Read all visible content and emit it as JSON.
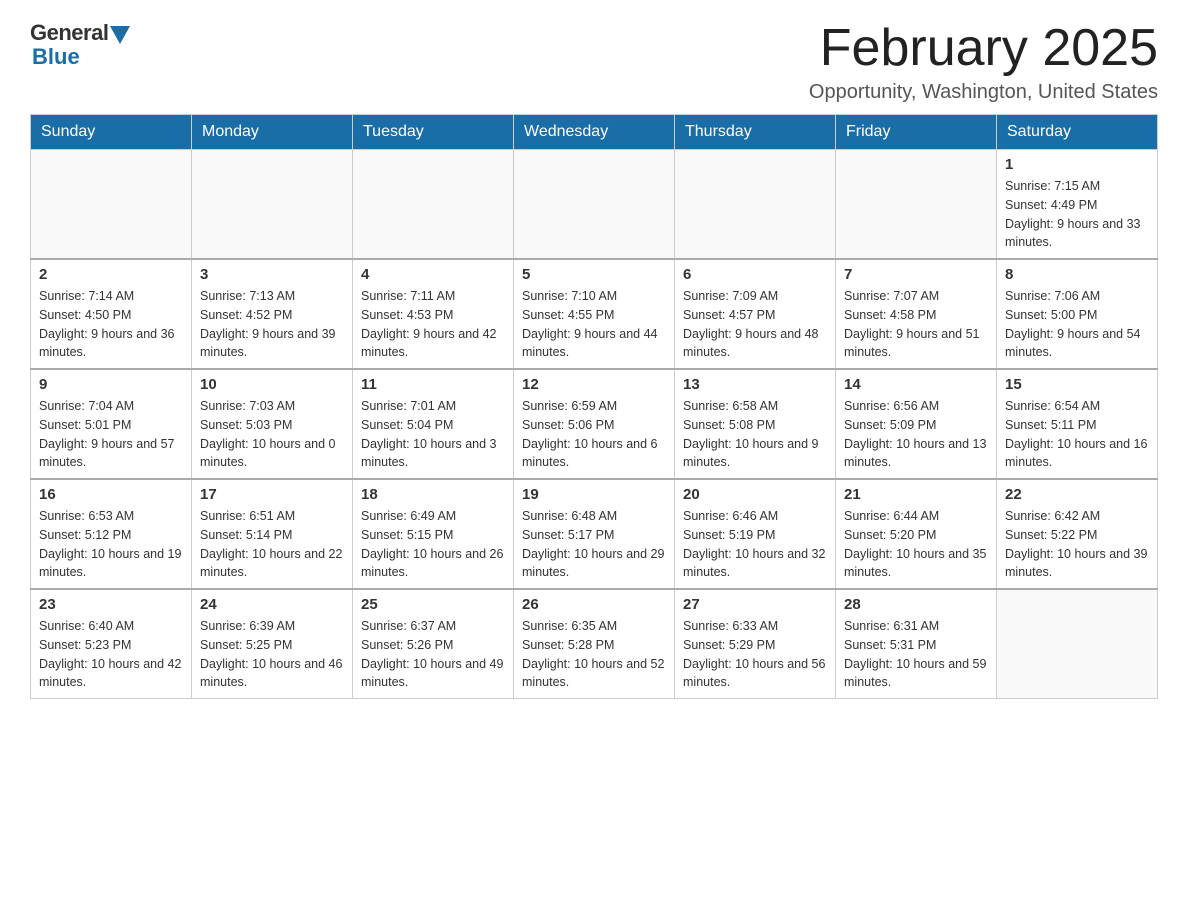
{
  "header": {
    "logo_general": "General",
    "logo_blue": "Blue",
    "month_title": "February 2025",
    "location": "Opportunity, Washington, United States"
  },
  "days_of_week": [
    "Sunday",
    "Monday",
    "Tuesday",
    "Wednesday",
    "Thursday",
    "Friday",
    "Saturday"
  ],
  "weeks": [
    [
      {
        "day": "",
        "info": ""
      },
      {
        "day": "",
        "info": ""
      },
      {
        "day": "",
        "info": ""
      },
      {
        "day": "",
        "info": ""
      },
      {
        "day": "",
        "info": ""
      },
      {
        "day": "",
        "info": ""
      },
      {
        "day": "1",
        "info": "Sunrise: 7:15 AM\nSunset: 4:49 PM\nDaylight: 9 hours and 33 minutes."
      }
    ],
    [
      {
        "day": "2",
        "info": "Sunrise: 7:14 AM\nSunset: 4:50 PM\nDaylight: 9 hours and 36 minutes."
      },
      {
        "day": "3",
        "info": "Sunrise: 7:13 AM\nSunset: 4:52 PM\nDaylight: 9 hours and 39 minutes."
      },
      {
        "day": "4",
        "info": "Sunrise: 7:11 AM\nSunset: 4:53 PM\nDaylight: 9 hours and 42 minutes."
      },
      {
        "day": "5",
        "info": "Sunrise: 7:10 AM\nSunset: 4:55 PM\nDaylight: 9 hours and 44 minutes."
      },
      {
        "day": "6",
        "info": "Sunrise: 7:09 AM\nSunset: 4:57 PM\nDaylight: 9 hours and 48 minutes."
      },
      {
        "day": "7",
        "info": "Sunrise: 7:07 AM\nSunset: 4:58 PM\nDaylight: 9 hours and 51 minutes."
      },
      {
        "day": "8",
        "info": "Sunrise: 7:06 AM\nSunset: 5:00 PM\nDaylight: 9 hours and 54 minutes."
      }
    ],
    [
      {
        "day": "9",
        "info": "Sunrise: 7:04 AM\nSunset: 5:01 PM\nDaylight: 9 hours and 57 minutes."
      },
      {
        "day": "10",
        "info": "Sunrise: 7:03 AM\nSunset: 5:03 PM\nDaylight: 10 hours and 0 minutes."
      },
      {
        "day": "11",
        "info": "Sunrise: 7:01 AM\nSunset: 5:04 PM\nDaylight: 10 hours and 3 minutes."
      },
      {
        "day": "12",
        "info": "Sunrise: 6:59 AM\nSunset: 5:06 PM\nDaylight: 10 hours and 6 minutes."
      },
      {
        "day": "13",
        "info": "Sunrise: 6:58 AM\nSunset: 5:08 PM\nDaylight: 10 hours and 9 minutes."
      },
      {
        "day": "14",
        "info": "Sunrise: 6:56 AM\nSunset: 5:09 PM\nDaylight: 10 hours and 13 minutes."
      },
      {
        "day": "15",
        "info": "Sunrise: 6:54 AM\nSunset: 5:11 PM\nDaylight: 10 hours and 16 minutes."
      }
    ],
    [
      {
        "day": "16",
        "info": "Sunrise: 6:53 AM\nSunset: 5:12 PM\nDaylight: 10 hours and 19 minutes."
      },
      {
        "day": "17",
        "info": "Sunrise: 6:51 AM\nSunset: 5:14 PM\nDaylight: 10 hours and 22 minutes."
      },
      {
        "day": "18",
        "info": "Sunrise: 6:49 AM\nSunset: 5:15 PM\nDaylight: 10 hours and 26 minutes."
      },
      {
        "day": "19",
        "info": "Sunrise: 6:48 AM\nSunset: 5:17 PM\nDaylight: 10 hours and 29 minutes."
      },
      {
        "day": "20",
        "info": "Sunrise: 6:46 AM\nSunset: 5:19 PM\nDaylight: 10 hours and 32 minutes."
      },
      {
        "day": "21",
        "info": "Sunrise: 6:44 AM\nSunset: 5:20 PM\nDaylight: 10 hours and 35 minutes."
      },
      {
        "day": "22",
        "info": "Sunrise: 6:42 AM\nSunset: 5:22 PM\nDaylight: 10 hours and 39 minutes."
      }
    ],
    [
      {
        "day": "23",
        "info": "Sunrise: 6:40 AM\nSunset: 5:23 PM\nDaylight: 10 hours and 42 minutes."
      },
      {
        "day": "24",
        "info": "Sunrise: 6:39 AM\nSunset: 5:25 PM\nDaylight: 10 hours and 46 minutes."
      },
      {
        "day": "25",
        "info": "Sunrise: 6:37 AM\nSunset: 5:26 PM\nDaylight: 10 hours and 49 minutes."
      },
      {
        "day": "26",
        "info": "Sunrise: 6:35 AM\nSunset: 5:28 PM\nDaylight: 10 hours and 52 minutes."
      },
      {
        "day": "27",
        "info": "Sunrise: 6:33 AM\nSunset: 5:29 PM\nDaylight: 10 hours and 56 minutes."
      },
      {
        "day": "28",
        "info": "Sunrise: 6:31 AM\nSunset: 5:31 PM\nDaylight: 10 hours and 59 minutes."
      },
      {
        "day": "",
        "info": ""
      }
    ]
  ]
}
